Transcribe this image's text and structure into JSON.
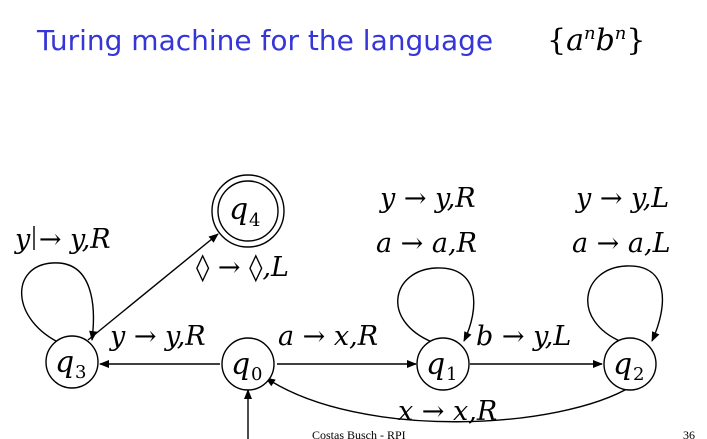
{
  "title": "Turing machine for the language",
  "language": {
    "a": "a",
    "b": "b",
    "exp": "n"
  },
  "states": {
    "q0": {
      "letter": "q",
      "index": "0"
    },
    "q1": {
      "letter": "q",
      "index": "1"
    },
    "q2": {
      "letter": "q",
      "index": "2"
    },
    "q3": {
      "letter": "q",
      "index": "3"
    },
    "q4": {
      "letter": "q",
      "index": "4"
    }
  },
  "transitions": {
    "q3_loop": "y → y,R",
    "q3_q4": "◊ → ◊,L",
    "q1_loop_y": "y → y,R",
    "q1_loop_a": "a → a,R",
    "q2_loop_y": "y → y,L",
    "q2_loop_a": "a → a,L",
    "q0_q3": "y → y,R",
    "q0_q1": "a → x,R",
    "q1_q2": "b → y,L",
    "q2_q0": "x → x,R"
  },
  "footer": {
    "author": "Costas Busch - RPI",
    "page": "36"
  }
}
